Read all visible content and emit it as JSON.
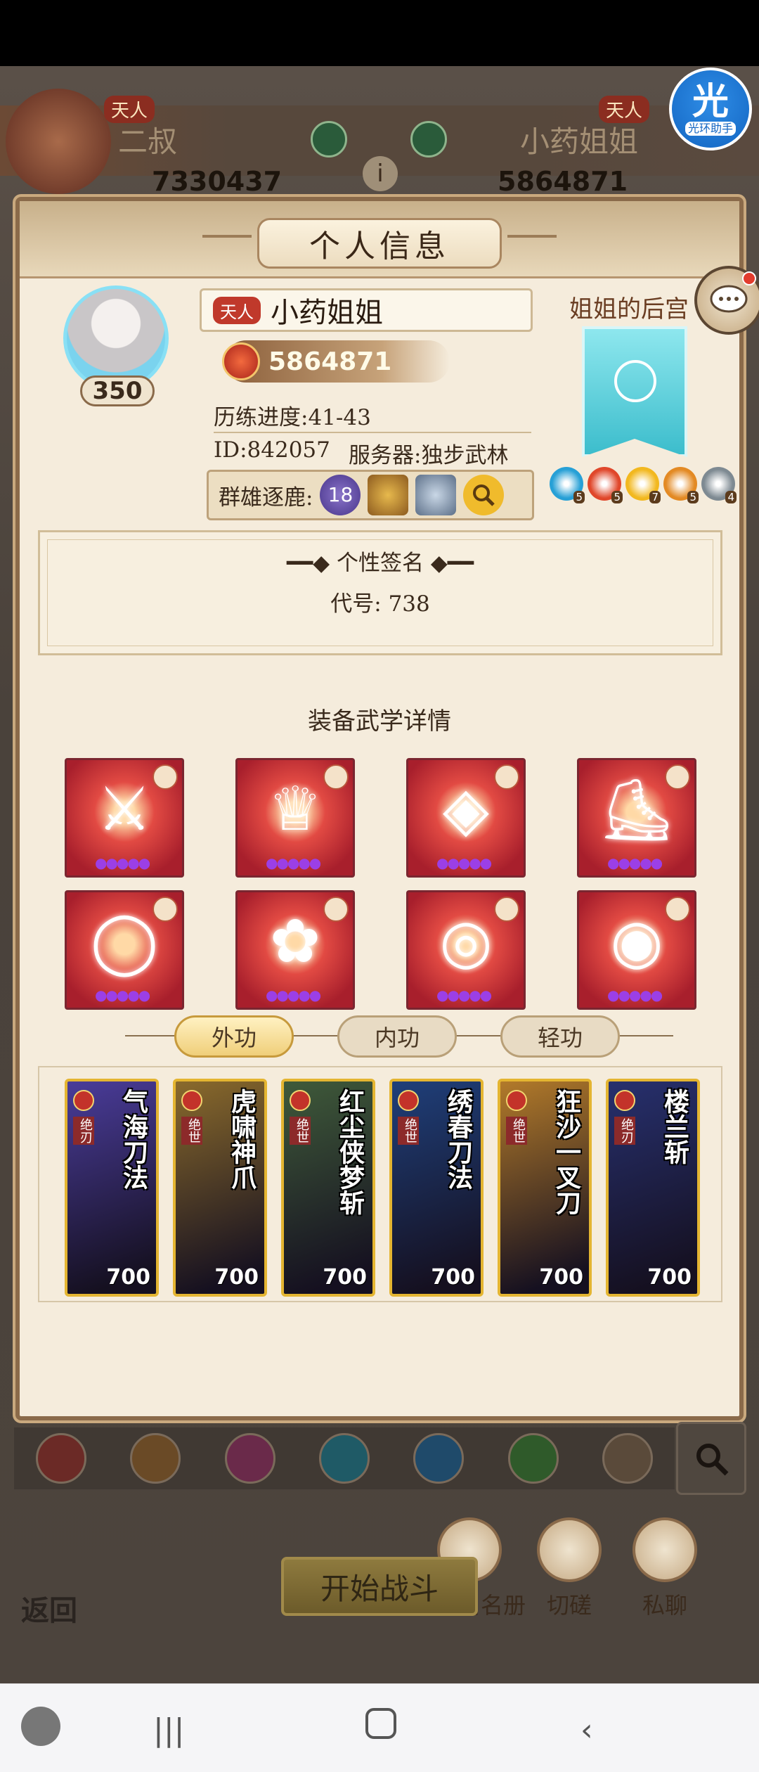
{
  "background": {
    "left_player": {
      "rank": "天人",
      "name": "二叔",
      "power": "7330437"
    },
    "right_player": {
      "rank": "天人",
      "name": "小药姐姐",
      "power": "5864871"
    },
    "info_icon": "info-icon",
    "assistant": {
      "big": "光",
      "small": "光环助手"
    }
  },
  "profile": {
    "title": "个人信息",
    "level": "350",
    "rank_tag": "天人",
    "name": "小药姐姐",
    "power": "5864871",
    "progress": "历练进度:41-43",
    "id": "ID:842057",
    "server": "服务器:独步武林",
    "clash_label": "群雄逐鹿:",
    "clash_rank": "18",
    "harem_title": "姐姐的后宫",
    "pets": [
      {
        "color": "#27a0d6",
        "level": "5"
      },
      {
        "color": "#e0472b",
        "level": "5"
      },
      {
        "color": "#f2b81f",
        "level": "7"
      },
      {
        "color": "#e38a24",
        "level": "5"
      },
      {
        "color": "#7e8a92",
        "level": "4"
      }
    ],
    "signature": {
      "title": "个性签名",
      "text": "代号: 738"
    }
  },
  "equipment": {
    "title": "装备武学详情",
    "items": [
      {
        "name": "sword",
        "glyph": "⚔"
      },
      {
        "name": "robe",
        "glyph": "♕"
      },
      {
        "name": "belt",
        "glyph": "◈"
      },
      {
        "name": "boots",
        "glyph": "⛸"
      },
      {
        "name": "necklace",
        "glyph": "◯"
      },
      {
        "name": "staff",
        "glyph": "✿"
      },
      {
        "name": "bracelet",
        "glyph": "◎"
      },
      {
        "name": "ring",
        "glyph": "◉"
      }
    ]
  },
  "tabs": [
    {
      "label": "外功",
      "active": true
    },
    {
      "label": "内功",
      "active": false
    },
    {
      "label": "轻功",
      "active": false
    }
  ],
  "skills": [
    {
      "name": "气海刀法",
      "tag": "绝刃",
      "power": "700",
      "bg": "#4a3c9a"
    },
    {
      "name": "虎啸神爪",
      "tag": "绝世",
      "power": "700",
      "bg": "#8a6a2c"
    },
    {
      "name": "红尘侠梦斩",
      "tag": "绝世",
      "power": "700",
      "bg": "#3f5a3a"
    },
    {
      "name": "绣春刀法",
      "tag": "绝世",
      "power": "700",
      "bg": "#1f3f7a"
    },
    {
      "name": "狂沙一叉刀",
      "tag": "绝世",
      "power": "700",
      "bg": "#b27a2a"
    },
    {
      "name": "楼兰斩",
      "tag": "绝刃",
      "power": "700",
      "bg": "#27306e"
    }
  ],
  "actions": {
    "remove": "移除白名册",
    "duel": "切磋",
    "chat": "私聊"
  },
  "bottom": {
    "start": "开始战斗",
    "back": "返回"
  }
}
